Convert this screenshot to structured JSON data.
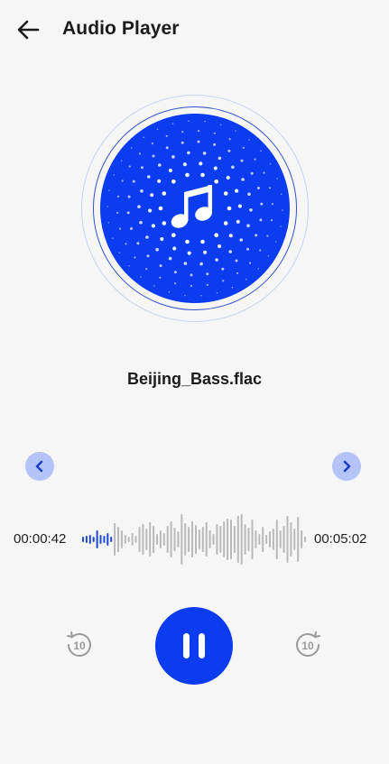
{
  "header": {
    "title": "Audio Player",
    "back_icon": "arrow-left-icon"
  },
  "artwork": {
    "icon": "music-note-icon",
    "accent_color": "#0b3cf0"
  },
  "track": {
    "filename": "Beijing_Bass.flac"
  },
  "navigation": {
    "prev_icon": "chevron-left-icon",
    "next_icon": "chevron-right-icon"
  },
  "playback": {
    "elapsed": "00:00:42",
    "total": "00:05:02",
    "progress_fraction": 0.14,
    "state": "playing"
  },
  "controls": {
    "rewind_seconds": "10",
    "forward_seconds": "10",
    "pause_icon": "pause-icon"
  },
  "colors": {
    "accent": "#0b3cf0",
    "waveform_played": "#1d47d8",
    "waveform_unplayed": "#b9b9b9",
    "nav_button_bg": "#b4c3f8"
  }
}
